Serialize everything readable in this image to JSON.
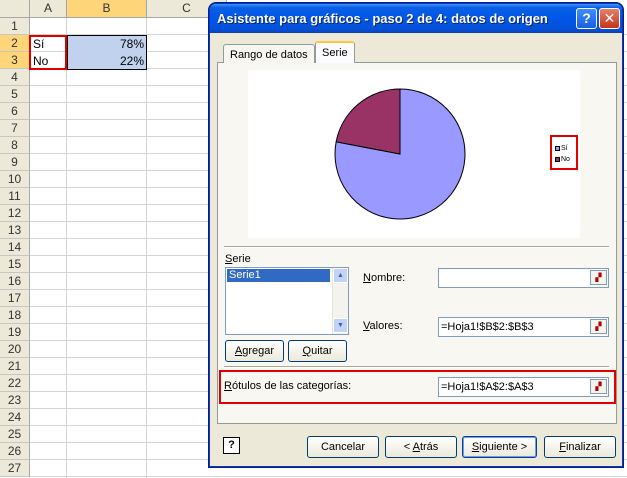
{
  "sheet": {
    "columns": [
      "A",
      "B",
      "C"
    ],
    "rows": [
      "1",
      "2",
      "3",
      "4",
      "5",
      "6",
      "7",
      "8",
      "9",
      "10",
      "11",
      "12",
      "13",
      "14",
      "15",
      "16",
      "17",
      "18",
      "19",
      "20",
      "21",
      "22",
      "23",
      "24",
      "25",
      "26",
      "27"
    ],
    "cells": {
      "a2": "Sí",
      "b2": "78%",
      "a3": "No",
      "b3": "22%"
    }
  },
  "dialog": {
    "title": "Asistente para gráficos - paso 2 de 4: datos de origen",
    "help_icon_label": "?",
    "close_icon_label": "✕",
    "tabs": {
      "rango": "Rango de datos",
      "serie": "Serie"
    },
    "serie_label_first": "S",
    "serie_label_rest": "erie",
    "series_list": [
      "Serie1"
    ],
    "agregar_first": "A",
    "agregar_rest": "gregar",
    "quitar_first": "Q",
    "quitar_rest": "uitar",
    "nombre_first": "N",
    "nombre_rest": "ombre:",
    "nombre_value": "",
    "valores_first": "V",
    "valores_rest": "alores:",
    "valores_value": "=Hoja1!$B$2:$B$3",
    "rotulos_first": "R",
    "rotulos_rest": "ótulos de las categorías:",
    "rotulos_value": "=Hoja1!$A$2:$A$3",
    "footer_help_label": "?",
    "buttons": {
      "cancelar": "Cancelar",
      "atras_prefix": "< ",
      "atras_first": "A",
      "atras_rest": "trás",
      "siguiente_first": "S",
      "siguiente_rest": "iguiente >",
      "finalizar_first": "F",
      "finalizar_rest": "inalizar"
    }
  },
  "chart_data": {
    "type": "pie",
    "categories": [
      "Sí",
      "No"
    ],
    "values": [
      0.78,
      0.22
    ],
    "colors": [
      "#9999ff",
      "#993366"
    ],
    "legend_position": "right"
  }
}
